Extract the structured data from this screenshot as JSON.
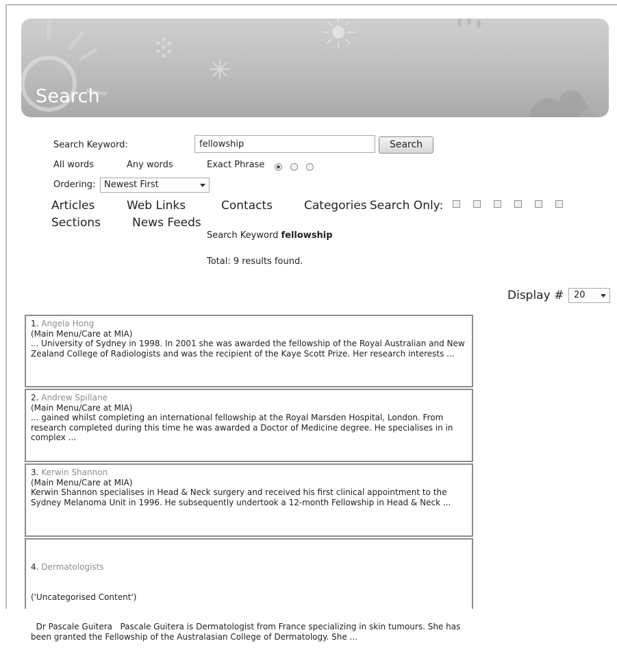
{
  "header": {
    "title": "Search"
  },
  "search": {
    "keyword_label": "Search Keyword:",
    "keyword_value": "fellowship",
    "button_label": "Search",
    "match_options": [
      "All words",
      "Any words",
      "Exact Phrase"
    ],
    "selected_match": "Exact Phrase",
    "ordering_label": "Ordering:",
    "ordering_value": "Newest First",
    "areas": [
      "Articles",
      "Web Links",
      "Contacts",
      "Categories",
      "Sections",
      "News Feeds"
    ],
    "areas_label": "Search Only:",
    "summary_prefix": "Search Keyword",
    "summary_keyword": "fellowship",
    "total_text": "Total: 9 results found.",
    "display_label": "Display #",
    "display_value": "20"
  },
  "results": [
    {
      "number": "1.",
      "title": "Angela Hong",
      "section": "(Main Menu/Care at MIA)",
      "snippet": "... University of Sydney in 1998. In 2001 she was awarded the fellowship of the Royal Australian and New Zealand College of Radiologists and was the recipient of the Kaye Scott Prize. Her research interests ..."
    },
    {
      "number": "2.",
      "title": "Andrew Spillane",
      "section": "(Main Menu/Care at MIA)",
      "snippet": "... gained whilst completing an international fellowship at the Royal Marsden Hospital, London. From research completed during this time he was awarded a Doctor of Medicine degree. He specialises in in complex ..."
    },
    {
      "number": "3.",
      "title": "Kerwin Shannon",
      "section": "(Main Menu/Care at MIA)",
      "snippet": "Kerwin Shannon specialises in Head & Neck surgery and received his first clinical appointment to the Sydney Melanoma Unit in 1996. He subsequently undertook a 12-month Fellowship in Head & Neck ..."
    },
    {
      "number": "4.",
      "title": "Dermatologists",
      "section": "('Uncategorised Content')",
      "snippet": "  Dr Pascale Guitera   Pascale Guitera is Dermatologist from France specializing in skin tumours. She has been granted the Fellowship of the Australasian College of Dermatology. She ..."
    }
  ]
}
